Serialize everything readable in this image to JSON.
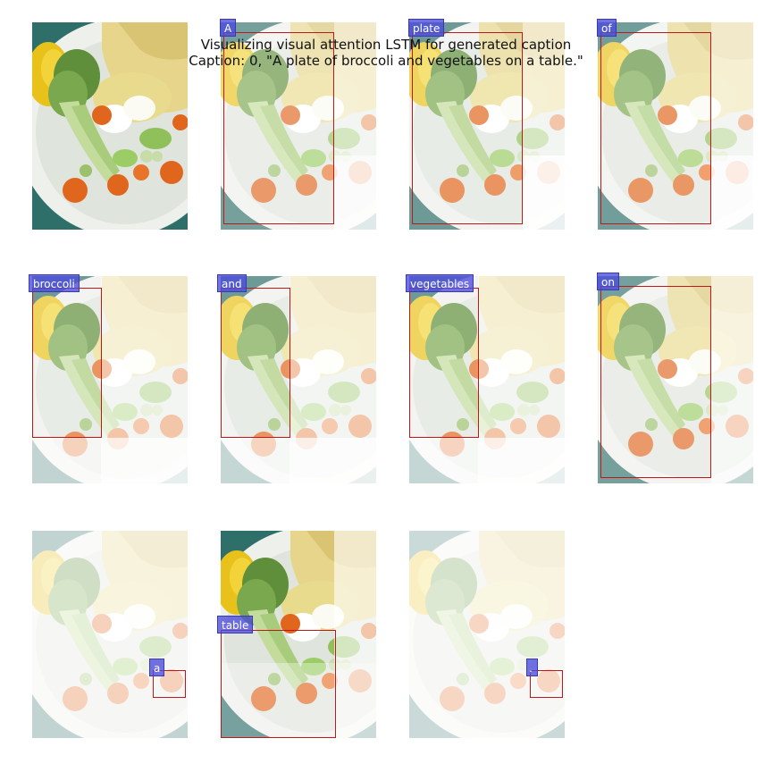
{
  "figure": {
    "title": "Visualizing visual attention LSTM for generated caption",
    "caption_line": "Caption: 0, \"A plate of broccoli and vegetables on a table.\""
  },
  "panels": [
    {
      "label": null
    },
    {
      "label": "A"
    },
    {
      "label": "plate"
    },
    {
      "label": "of"
    },
    {
      "label": "broccoli"
    },
    {
      "label": "and"
    },
    {
      "label": "vegetables"
    },
    {
      "label": "on"
    },
    {
      "label": "a"
    },
    {
      "label": "table"
    },
    {
      "label": "."
    }
  ],
  "colors": {
    "word_tag": "#4a4ade",
    "attention_box": "#c01818",
    "background": "#ffffff"
  }
}
